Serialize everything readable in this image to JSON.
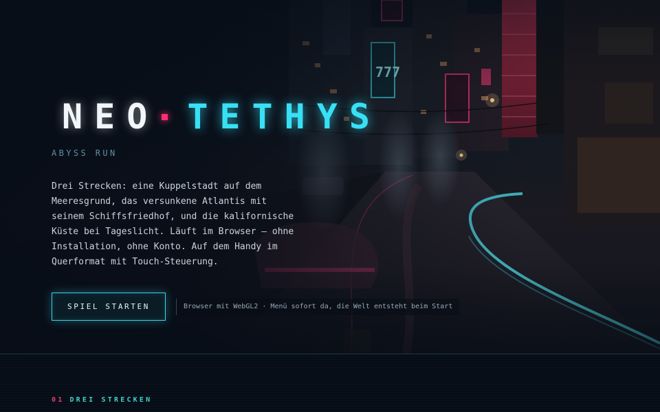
{
  "hero": {
    "title_part1": "NEO",
    "title_part2": "TETHYS",
    "tagline": "ABYSS RUN",
    "description": "Drei Strecken: eine Kuppelstadt auf dem Meeresgrund, das versunkene Atlantis mit seinem Schiffsfriedhof, und die kalifornische Küste bei Tageslicht. Läuft im Browser — ohne Installation, ohne Konto. Auf dem Handy im Querformat mit Touch-Steuerung.",
    "start_button_label": "SPIEL STARTEN",
    "requirements_note": "Browser mit WebGL2 · Menü sofort da, die Welt entsteht beim Start",
    "background_sign_text": "777"
  },
  "section": {
    "number": "01",
    "title": "DREI STRECKEN"
  },
  "colors": {
    "background": "#070d17",
    "accent_cyan": "#38e0f5",
    "accent_pink": "#ff2e74",
    "section_title": "#3fd2c8",
    "text": "#c9d4e0",
    "muted": "#5f8ea3"
  }
}
